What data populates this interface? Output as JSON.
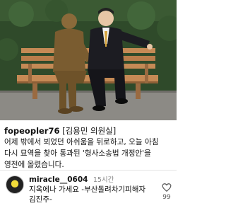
{
  "post": {
    "photo_alt": "",
    "caption": {
      "handle": "fopeopler76",
      "tag": "[김용민 의원실]",
      "lines": [
        "어제 밖에서 뵈었던 아쉬움을 뒤로하고, 오늘 아침",
        "다시 묘역을 찾아 통과된 '형사소송법 개정안'을",
        "영전에 올렸습니다."
      ]
    }
  },
  "comment": {
    "username": "miracle__0604",
    "time": "15시간",
    "lines": [
      "지옥에나 가세요 -부산돌려차기피해자",
      "김진주-"
    ],
    "likes": "99"
  },
  "colors": {
    "hedge": "#2f4a2a",
    "bench": "#c58a55",
    "statue": "#8a6a3a",
    "suit": "#1c1c22",
    "ground": "#8c8a85"
  }
}
